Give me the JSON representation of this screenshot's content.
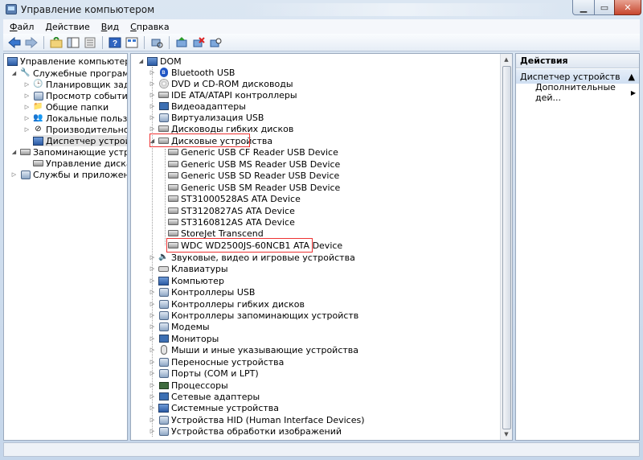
{
  "window": {
    "title": "Управление компьютером"
  },
  "menu": [
    {
      "label": "Файл",
      "accel": "Ф",
      "rest": "айл"
    },
    {
      "label": "Действие",
      "accel": "Д",
      "rest": "ействие"
    },
    {
      "label": "Вид",
      "accel": "В",
      "rest": "ид"
    },
    {
      "label": "Справка",
      "accel": "С",
      "rest": "правка"
    }
  ],
  "left_tree": {
    "root": "Управление компьютером (л",
    "items": [
      {
        "label": "Служебные программы"
      },
      {
        "label": "Планировщик заданий"
      },
      {
        "label": "Просмотр событий"
      },
      {
        "label": "Общие папки"
      },
      {
        "label": "Локальные пользовате"
      },
      {
        "label": "Производительность"
      },
      {
        "label": "Диспетчер устройств"
      },
      {
        "label": "Запоминающие устройст"
      },
      {
        "label": "Управление дисками"
      },
      {
        "label": "Службы и приложения"
      }
    ]
  },
  "device_tree": {
    "root": "DOM",
    "categories_top": [
      "Bluetooth USB",
      "DVD и CD-ROM дисководы",
      "IDE ATA/ATAPI контроллеры",
      "Видеоадаптеры",
      "Виртуализация USB",
      "Дисководы гибких дисков",
      "Дисковые устройства"
    ],
    "disk_devices": [
      "Generic USB CF Reader USB Device",
      "Generic USB MS Reader USB Device",
      "Generic USB SD Reader USB Device",
      "Generic USB SM Reader USB Device",
      "ST31000528AS ATA Device",
      "ST3120827AS ATA Device",
      "ST3160812AS ATA Device",
      "StoreJet Transcend",
      "WDC WD2500JS-60NCB1 ATA Device"
    ],
    "categories_bottom": [
      "Звуковые, видео и игровые устройства",
      "Клавиатуры",
      "Компьютер",
      "Контроллеры USB",
      "Контроллеры гибких дисков",
      "Контроллеры запоминающих устройств",
      "Модемы",
      "Мониторы",
      "Мыши и иные указывающие устройства",
      "Переносные устройства",
      "Порты (COM и LPT)",
      "Процессоры",
      "Сетевые адаптеры",
      "Системные устройства",
      "Устройства HID (Human Interface Devices)",
      "Устройства обработки изображений"
    ]
  },
  "actions": {
    "header": "Действия",
    "section": "Диспетчер устройств",
    "item": "Дополнительные дей..."
  },
  "colors": {
    "highlight_box": "#e33333",
    "selection_bg": "#cfdff2"
  }
}
